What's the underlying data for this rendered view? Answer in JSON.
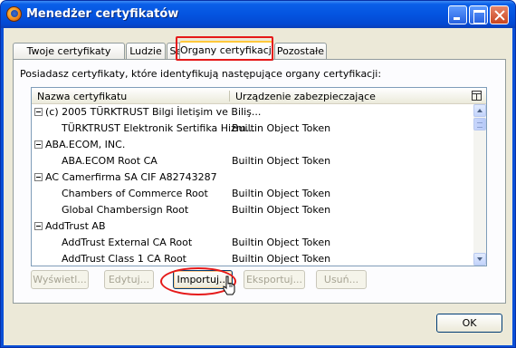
{
  "window": {
    "title": "Menedżer certyfikatów"
  },
  "tabs": [
    {
      "label": "Twoje certyfikaty"
    },
    {
      "label": "Ludzie"
    },
    {
      "label": "Serwery"
    },
    {
      "label": "Organy certyfikacji",
      "active": true
    },
    {
      "label": "Pozostałe"
    }
  ],
  "description": "Posiadasz certyfikaty, które identyfikują następujące organy certyfikacji:",
  "tree": {
    "columns": [
      "Nazwa certyfikatu",
      "Urządzenie zabezpieczające"
    ],
    "rows": [
      {
        "name": "(c) 2005 TÜRKTRUST Bilgi İletişim ve Biliş...",
        "device": "",
        "group": true
      },
      {
        "name": "TÜRKTRUST Elektronik Sertifika Hizm...",
        "device": "Builtin Object Token",
        "group": false
      },
      {
        "name": "ABA.ECOM, INC.",
        "device": "",
        "group": true
      },
      {
        "name": "ABA.ECOM Root CA",
        "device": "Builtin Object Token",
        "group": false
      },
      {
        "name": "AC Camerfirma SA CIF A82743287",
        "device": "",
        "group": true
      },
      {
        "name": "Chambers of Commerce Root",
        "device": "Builtin Object Token",
        "group": false
      },
      {
        "name": "Global Chambersign Root",
        "device": "Builtin Object Token",
        "group": false
      },
      {
        "name": "AddTrust AB",
        "device": "",
        "group": true
      },
      {
        "name": "AddTrust External CA Root",
        "device": "Builtin Object Token",
        "group": false
      },
      {
        "name": "AddTrust Class 1 CA Root",
        "device": "Builtin Object Token",
        "group": false
      }
    ]
  },
  "buttons": {
    "view": "Wyświetl...",
    "edit": "Edytuj...",
    "import": "Importuj...",
    "export": "Eksportuj...",
    "delete": "Usuń...",
    "ok": "OK"
  },
  "colors": {
    "highlight": "#e51919",
    "titlebar": "#0454e0",
    "dialog_bg": "#ece9d8"
  }
}
